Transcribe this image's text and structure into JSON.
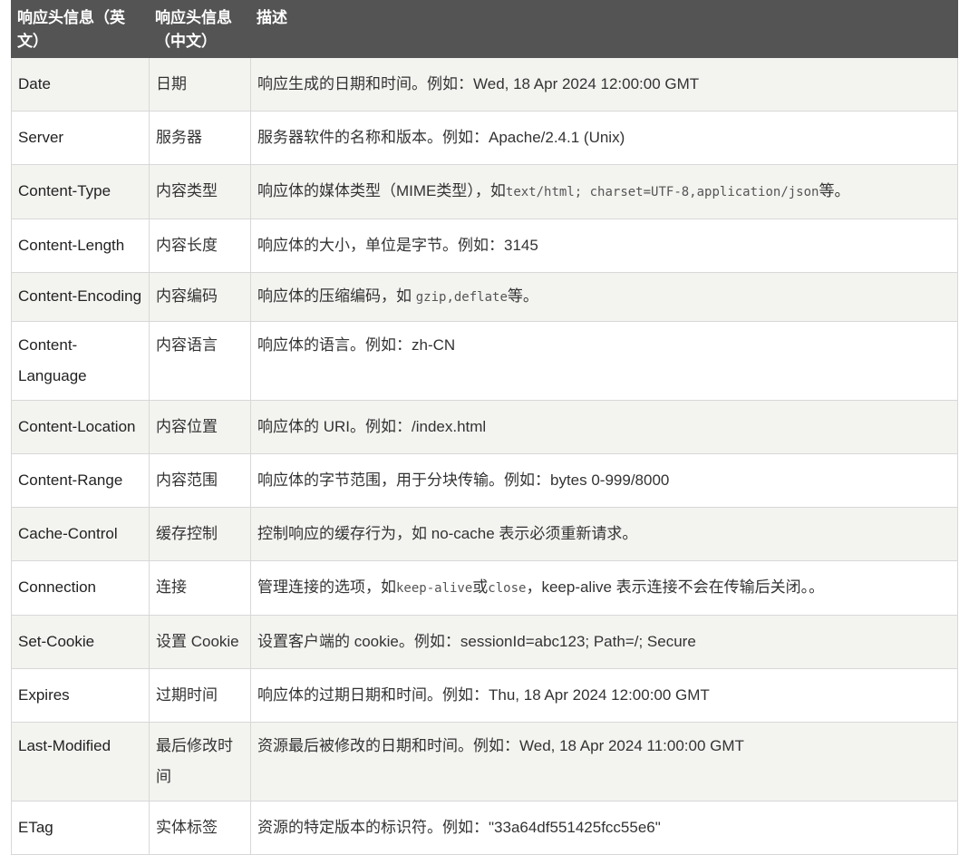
{
  "header": {
    "col_en": "响应头信息（英文）",
    "col_zh": "响应头信息（中文）",
    "col_desc": "描述"
  },
  "rows": [
    {
      "en": "Date",
      "zh": "日期",
      "desc_pre": "响应生成的日期和时间。例如：",
      "desc_value": "Wed, 18 Apr 2024 12:00:00 GMT"
    },
    {
      "en": "Server",
      "zh": "服务器",
      "desc_pre": "服务器软件的名称和版本。例如：",
      "desc_value": "Apache/2.4.1 (Unix)"
    },
    {
      "en": "Content-Type",
      "zh": "内容类型",
      "desc_pre": "响应体的媒体类型（MIME类型），如",
      "desc_code": "text/html; charset=UTF-8,application/json",
      "desc_post": "等。"
    },
    {
      "en": "Content-Length",
      "zh": "内容长度",
      "desc_pre": "响应体的大小，单位是字节。例如：",
      "desc_value": "3145"
    },
    {
      "en": "Content-Encoding",
      "zh": "内容编码",
      "desc_pre": "响应体的压缩编码，如 ",
      "desc_code": "gzip,deflate",
      "desc_post": "等。"
    },
    {
      "en": "Content-Language",
      "zh": "内容语言",
      "desc_pre": "响应体的语言。例如：",
      "desc_value": "zh-CN"
    },
    {
      "en": "Content-Location",
      "zh": "内容位置",
      "desc_pre": "响应体的 URI。例如：",
      "desc_value": "/index.html"
    },
    {
      "en": "Content-Range",
      "zh": "内容范围",
      "desc_pre": "响应体的字节范围，用于分块传输。例如：",
      "desc_value": "bytes 0-999/8000"
    },
    {
      "en": "Cache-Control",
      "zh": "缓存控制",
      "desc_pre": "控制响应的缓存行为，如 ",
      "desc_value": "no-cache",
      "desc_post": " 表示必须重新请求。"
    },
    {
      "en": "Connection",
      "zh": "连接",
      "desc_pre": "管理连接的选项，如",
      "desc_code": "keep-alive",
      "desc_mid": "或",
      "desc_code2": "close",
      "desc_mid2": "，",
      "desc_value": "keep-alive",
      "desc_post": " 表示连接不会在传输后关闭。。"
    },
    {
      "en": "Set-Cookie",
      "zh": "设置 Cookie",
      "desc_pre": "设置客户端的 cookie。例如：",
      "desc_value": "sessionId=abc123; Path=/; Secure"
    },
    {
      "en": "Expires",
      "zh": "过期时间",
      "desc_pre": "响应体的过期日期和时间。例如：",
      "desc_value": "Thu, 18 Apr 2024 12:00:00 GMT"
    },
    {
      "en": "Last-Modified",
      "zh": "最后修改时间",
      "desc_pre": "资源最后被修改的日期和时间。例如：",
      "desc_value": "Wed, 18 Apr 2024 11:00:00 GMT"
    },
    {
      "en": "ETag",
      "zh": "实体标签",
      "desc_pre": "资源的特定版本的标识符。例如：",
      "desc_value": "\"33a64df551425fcc55e6\""
    }
  ]
}
